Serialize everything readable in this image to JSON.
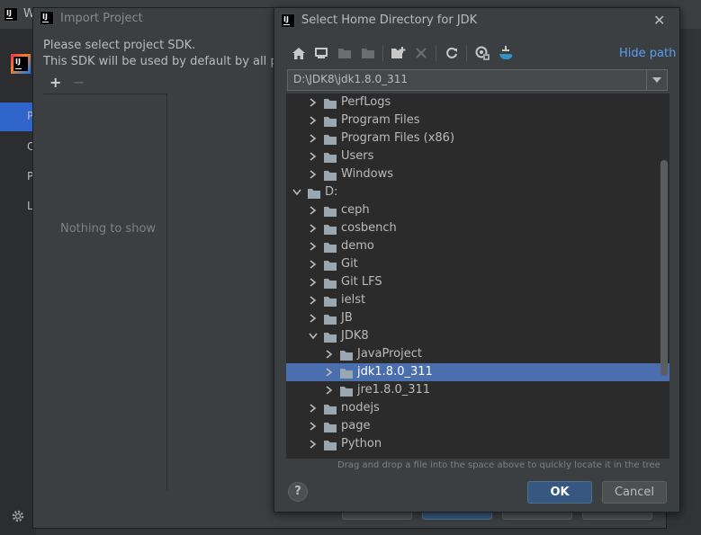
{
  "welcome": {
    "title_initial": "W",
    "side_letters": [
      "P",
      "C",
      "P",
      "L"
    ]
  },
  "import_dialog": {
    "title": "Import Project",
    "message_line1": "Please select project SDK.",
    "message_line2": "This SDK will be used by default by all proje",
    "add_symbol": "+",
    "remove_symbol": "−",
    "empty_text": "Nothing to show"
  },
  "jdk_dialog": {
    "title": "Select Home Directory for JDK",
    "close_symbol": "✕",
    "toolbar": [
      "home-icon",
      "desktop-icon",
      "project-folder-icon",
      "module-folder-icon",
      "new-folder-icon",
      "delete-icon",
      "refresh-icon",
      "show-hidden-icon",
      "jdk-icon"
    ],
    "hide_path_label": "Hide path",
    "path_value": "D:\\JDK8\\jdk1.8.0_311",
    "tree": [
      {
        "label": "PerfLogs",
        "level": 1,
        "expanded": false,
        "selected": false
      },
      {
        "label": "Program Files",
        "level": 1,
        "expanded": false,
        "selected": false
      },
      {
        "label": "Program Files (x86)",
        "level": 1,
        "expanded": false,
        "selected": false
      },
      {
        "label": "Users",
        "level": 1,
        "expanded": false,
        "selected": false
      },
      {
        "label": "Windows",
        "level": 1,
        "expanded": false,
        "selected": false
      },
      {
        "label": "D:",
        "level": 0,
        "expanded": true,
        "selected": false
      },
      {
        "label": "ceph",
        "level": 1,
        "expanded": false,
        "selected": false
      },
      {
        "label": "cosbench",
        "level": 1,
        "expanded": false,
        "selected": false
      },
      {
        "label": "demo",
        "level": 1,
        "expanded": false,
        "selected": false
      },
      {
        "label": "Git",
        "level": 1,
        "expanded": false,
        "selected": false
      },
      {
        "label": "Git LFS",
        "level": 1,
        "expanded": false,
        "selected": false
      },
      {
        "label": "ielst",
        "level": 1,
        "expanded": false,
        "selected": false
      },
      {
        "label": "JB",
        "level": 1,
        "expanded": false,
        "selected": false
      },
      {
        "label": "JDK8",
        "level": 1,
        "expanded": true,
        "selected": false
      },
      {
        "label": "JavaProject",
        "level": 2,
        "expanded": false,
        "selected": false
      },
      {
        "label": "jdk1.8.0_311",
        "level": 2,
        "expanded": false,
        "selected": true
      },
      {
        "label": "jre1.8.0_311",
        "level": 2,
        "expanded": false,
        "selected": false
      },
      {
        "label": "nodejs",
        "level": 1,
        "expanded": false,
        "selected": false
      },
      {
        "label": "page",
        "level": 1,
        "expanded": false,
        "selected": false
      },
      {
        "label": "Python",
        "level": 1,
        "expanded": false,
        "selected": false
      }
    ],
    "hint": "Drag and drop a file into the space above to quickly locate it in the tree",
    "help_label": "?",
    "ok_label": "OK",
    "cancel_label": "Cancel",
    "colors": {
      "selection": "#4b6eaf",
      "ok": "#365880",
      "link": "#589df6"
    }
  }
}
